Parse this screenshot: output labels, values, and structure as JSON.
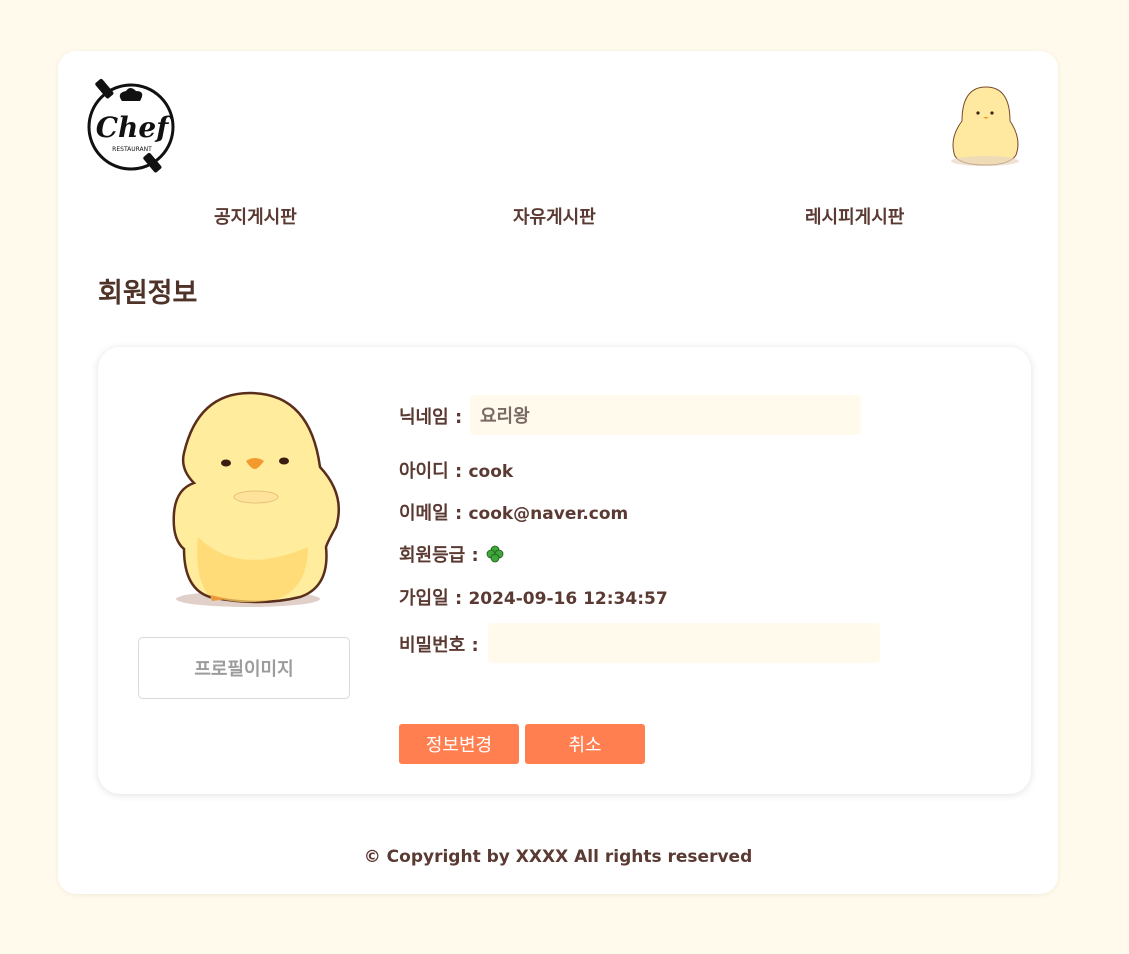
{
  "header": {
    "logo_text": "Chef",
    "logo_subtext": "RESTAURANT"
  },
  "nav": {
    "items": [
      {
        "label": "공지게시판"
      },
      {
        "label": "자유게시판"
      },
      {
        "label": "레시피게시판"
      }
    ]
  },
  "page": {
    "title": "회원정보"
  },
  "profile": {
    "image_button_label": "프로필이미지",
    "nickname_label": "닉네임 :",
    "nickname_value": "요리왕",
    "id_label": "아이디 :",
    "id_value": "cook",
    "email_label": "이메일 :",
    "email_value": "cook@naver.com",
    "grade_label": "회원등급 :",
    "grade_icon": "four-leaf-clover-icon",
    "join_label": "가입일 :",
    "join_value": "2024-09-16 12:34:57",
    "password_label": "비밀번호 :",
    "password_value": ""
  },
  "actions": {
    "save_label": "정보변경",
    "cancel_label": "취소"
  },
  "footer": {
    "text": "© Copyright by XXXX All rights reserved"
  },
  "colors": {
    "background": "#fffaeb",
    "text": "#5a3a32",
    "accent_button": "#ff7f50",
    "input_bg": "#fffaeb"
  }
}
